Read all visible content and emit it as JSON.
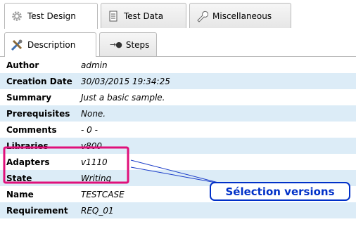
{
  "tabs": [
    {
      "label": "Test Design",
      "icon": "gear-icon"
    },
    {
      "label": "Test Data",
      "icon": "document-icon"
    },
    {
      "label": "Miscellaneous",
      "icon": "wrench-icon"
    }
  ],
  "subtabs": [
    {
      "label": "Description",
      "icon": "tools-icon"
    },
    {
      "label": "Steps",
      "icon": "steps-icon"
    }
  ],
  "properties": [
    {
      "key": "Author",
      "value": "admin"
    },
    {
      "key": "Creation Date",
      "value": "30/03/2015 19:34:25"
    },
    {
      "key": "Summary",
      "value": "Just a basic sample."
    },
    {
      "key": "Prerequisites",
      "value": "None."
    },
    {
      "key": "Comments",
      "value": "- 0 -"
    },
    {
      "key": "Libraries",
      "value": "v800"
    },
    {
      "key": "Adapters",
      "value": "v1110"
    },
    {
      "key": "State",
      "value": "Writing"
    },
    {
      "key": "Name",
      "value": "TESTCASE"
    },
    {
      "key": "Requirement",
      "value": "REQ_01"
    }
  ],
  "annotation": {
    "callout_text": "Sélection versions",
    "highlight_color": "#e0107a",
    "callout_color": "#0030c8"
  },
  "colors": {
    "row_alt": "#dcecf7",
    "tab_border": "#b9b9b9"
  }
}
